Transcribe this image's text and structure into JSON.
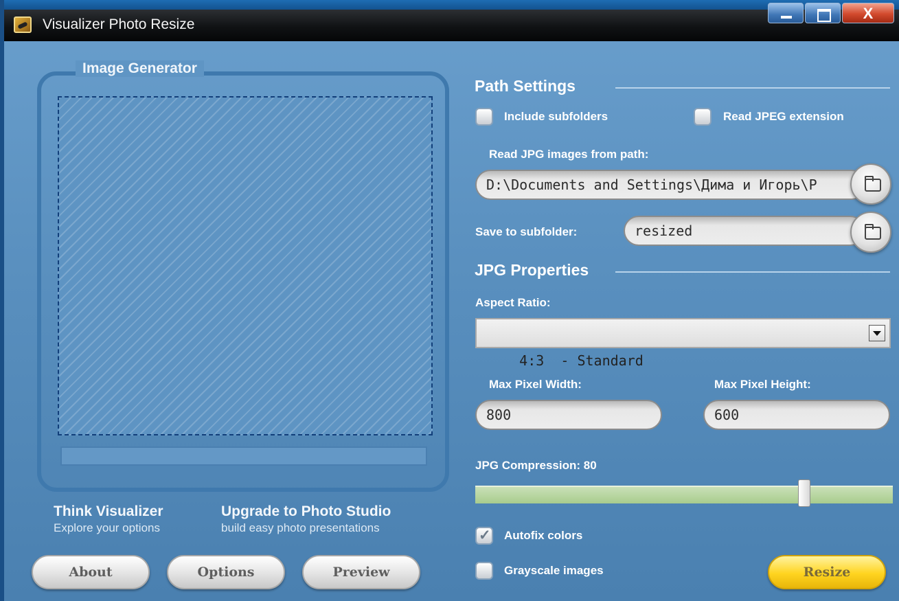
{
  "window": {
    "title": "Visualizer Photo Resize",
    "controls": {
      "minimize": "minimize-icon",
      "maximize": "maximize-icon",
      "close": "X"
    }
  },
  "image_generator": {
    "legend": "Image Generator"
  },
  "promos": [
    {
      "heading": "Think Visualizer",
      "subtext": "Explore your options"
    },
    {
      "heading": "Upgrade to Photo Studio",
      "subtext": "build easy photo presentations"
    }
  ],
  "buttons": {
    "about": "About",
    "options": "Options",
    "preview": "Preview",
    "resize": "Resize"
  },
  "path_settings": {
    "title": "Path Settings",
    "include_subfolders": {
      "label": "Include subfolders",
      "checked": false
    },
    "read_jpeg_extension": {
      "label": "Read JPEG extension",
      "checked": false
    },
    "read_path_label": "Read JPG images from path:",
    "read_path_value": "D:\\Documents and Settings\\Дима и Игорь\\Р",
    "save_subfolder_label": "Save to subfolder:",
    "save_subfolder_value": "resized"
  },
  "jpg_properties": {
    "title": "JPG Properties",
    "aspect_ratio_label": "Aspect Ratio:",
    "aspect_ratio_value": "4:3  - Standard",
    "max_width_label": "Max Pixel Width:",
    "max_width_value": "800",
    "max_height_label": "Max Pixel Height:",
    "max_height_value": "600",
    "compression_label": "JPG Compression: 80",
    "compression_value": 80,
    "autofix_colors": {
      "label": "Autofix colors",
      "checked": true
    },
    "grayscale_images": {
      "label": "Grayscale images",
      "checked": false
    }
  },
  "colors": {
    "panel_bg": "#5b91c0",
    "titlebar_bg": "#101214",
    "resize_button": "#ffd41f",
    "slider_track": "#a8cc8d",
    "close_button": "#d24a2d"
  }
}
